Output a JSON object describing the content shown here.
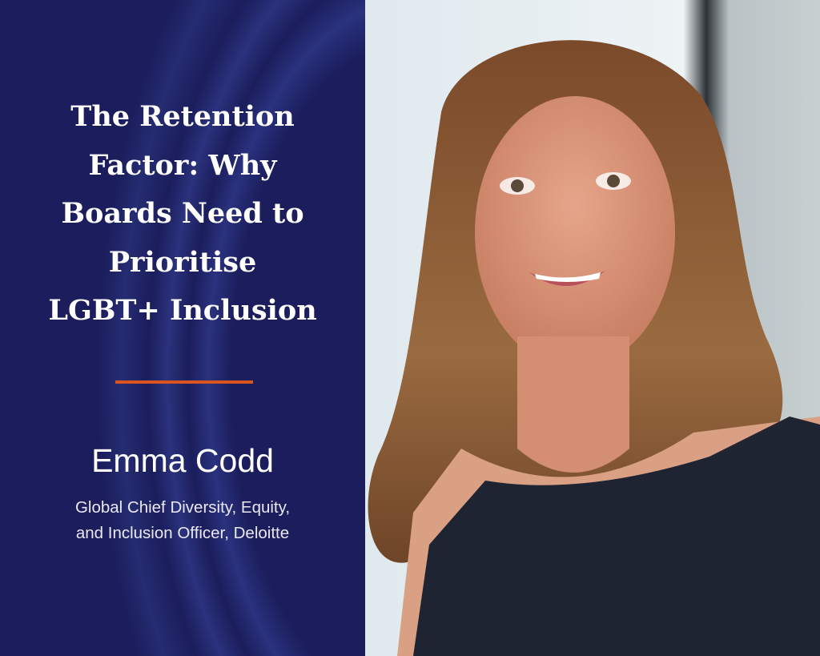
{
  "title_lines": [
    "The Retention",
    "Factor: Why",
    "Boards Need to",
    "Prioritise",
    "LGBT+  Inclusion"
  ],
  "speaker": {
    "name": "Emma Codd",
    "role_lines": [
      "Global Chief Diversity, Equity,",
      "and Inclusion Officer, Deloitte"
    ]
  },
  "colors": {
    "panel": "#1b1d5c",
    "accent_rule": "#d9541e",
    "text": "#ffffff"
  }
}
